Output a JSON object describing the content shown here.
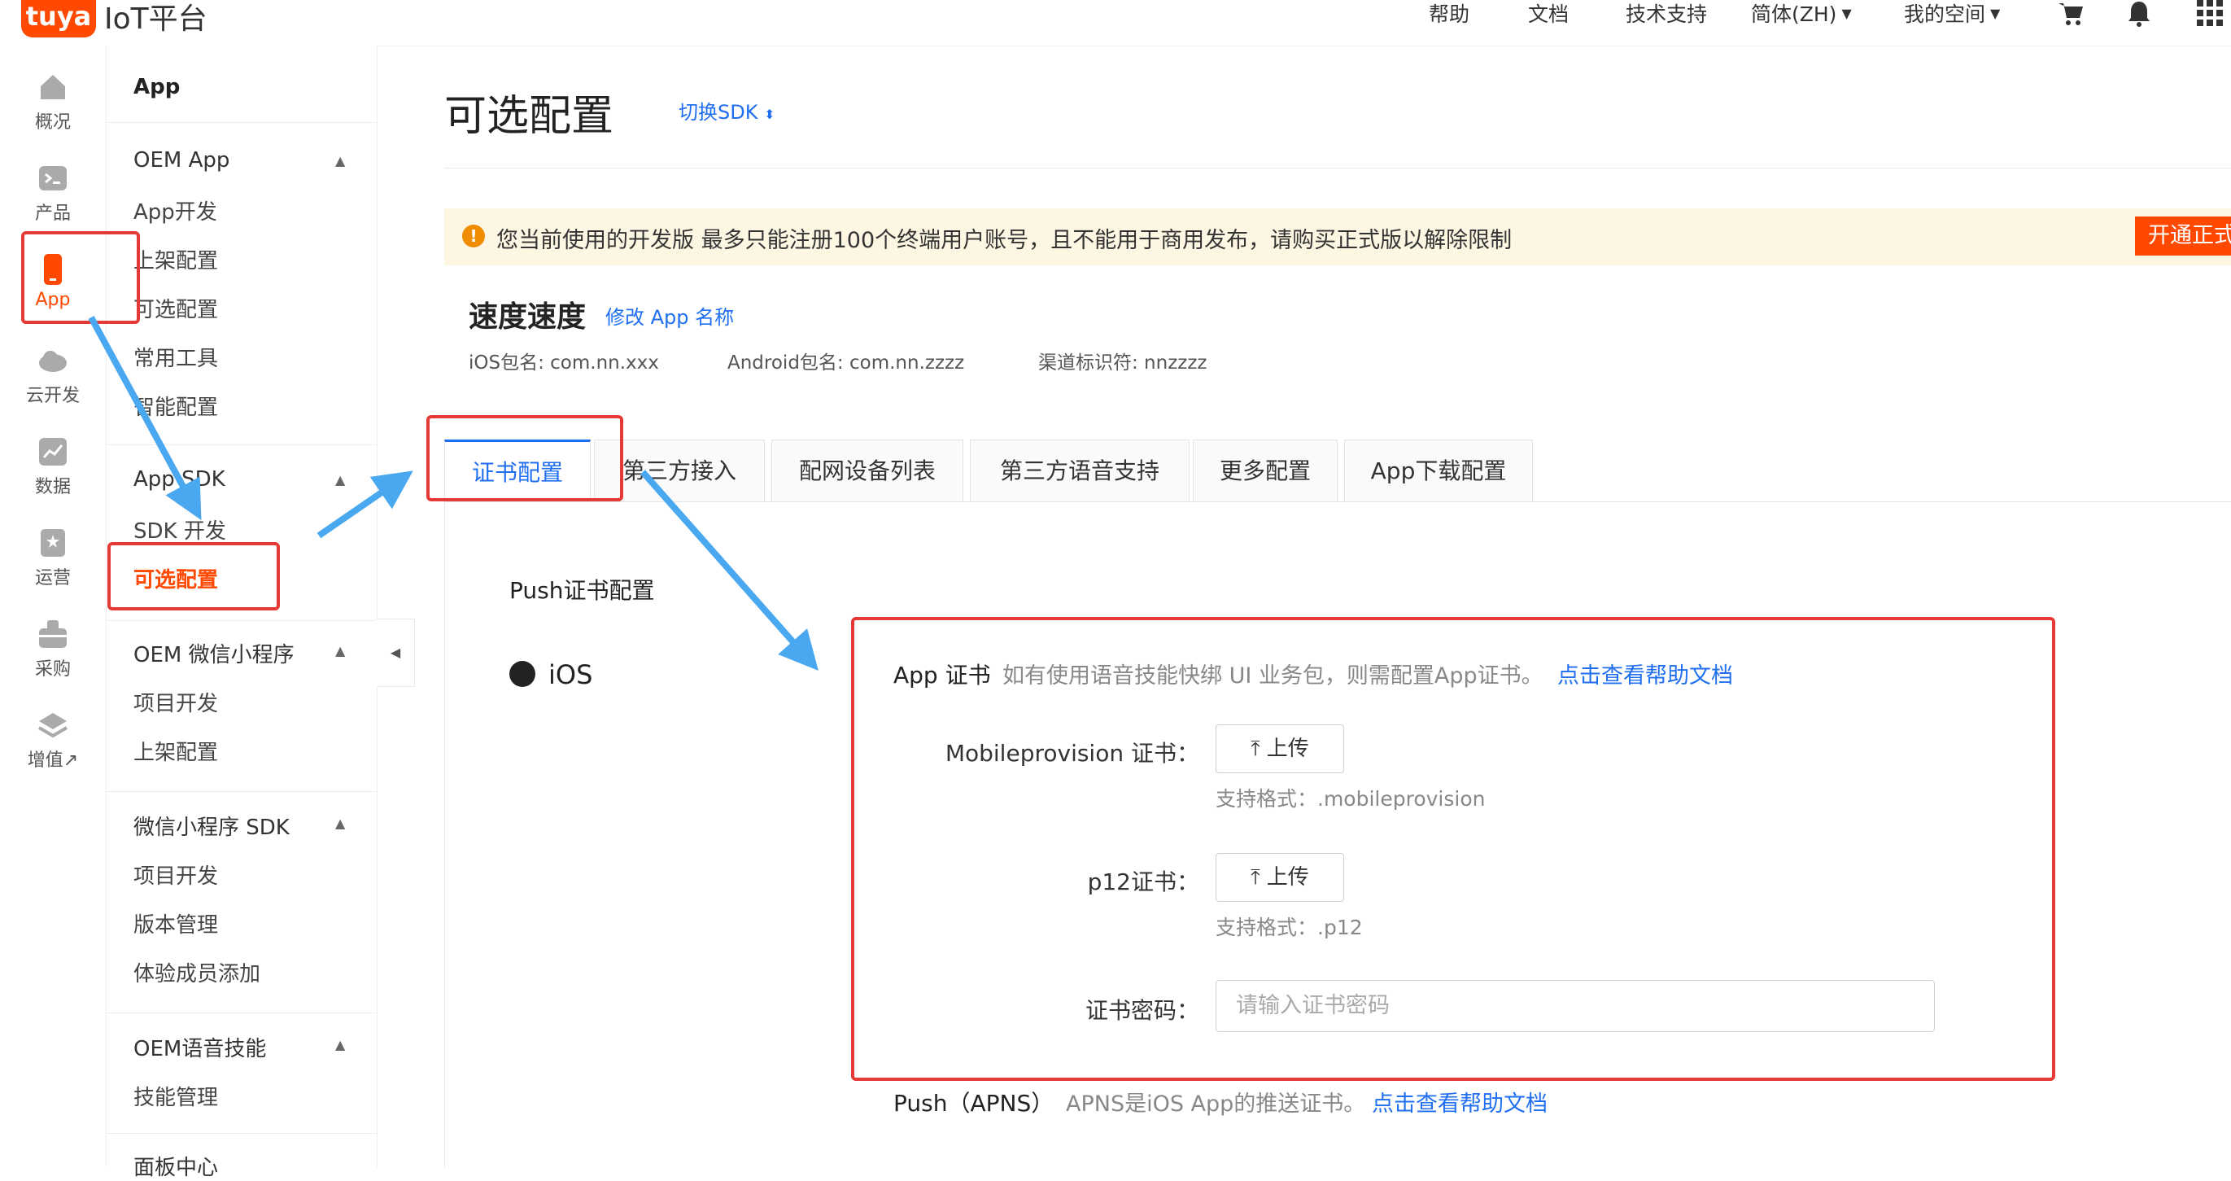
{
  "header": {
    "logo": "tuya",
    "platform": "IoT平台",
    "nav": [
      "帮助",
      "文档",
      "技术支持",
      "简体(ZH)",
      "我的空间"
    ],
    "icons": [
      "cart-icon",
      "bell-icon",
      "grid-icon"
    ]
  },
  "rail": [
    {
      "label": "概况",
      "icon": "home-icon"
    },
    {
      "label": "产品",
      "icon": "terminal-icon"
    },
    {
      "label": "App",
      "icon": "phone-icon",
      "active": true
    },
    {
      "label": "云开发",
      "icon": "cloud-icon"
    },
    {
      "label": "数据",
      "icon": "chart-icon"
    },
    {
      "label": "运营",
      "icon": "bookmark-icon"
    },
    {
      "label": "采购",
      "icon": "basket-icon"
    },
    {
      "label": "增值↗",
      "icon": "layers-icon"
    }
  ],
  "submenu": {
    "root": "App",
    "groups": [
      {
        "title": "OEM App",
        "items": [
          "App开发",
          "上架配置",
          "可选配置",
          "常用工具",
          "智能配置"
        ]
      },
      {
        "title": "App SDK",
        "items": [
          "SDK 开发",
          "可选配置"
        ],
        "active": "可选配置"
      },
      {
        "title": "OEM 微信小程序",
        "items": [
          "项目开发",
          "上架配置"
        ]
      },
      {
        "title": "微信小程序 SDK",
        "items": [
          "项目开发",
          "版本管理",
          "体验成员添加"
        ]
      },
      {
        "title": "OEM语音技能",
        "items": [
          "技能管理"
        ]
      },
      {
        "title": "面板中心",
        "items": []
      }
    ]
  },
  "page": {
    "title": "可选配置",
    "switch_sdk": "切换SDK",
    "warning": "您当前使用的开发版 最多只能注册100个终端用户账号，且不能用于商用发布，请购买正式版以解除限制",
    "warning_btn": "开通正式版",
    "app_name": "速度速度",
    "rename": "修改 App 名称",
    "ios_pkg": "iOS包名: com.nn.xxx",
    "android_pkg": "Android包名: com.nn.zzzz",
    "channel": "渠道标识符: nnzzzz"
  },
  "tabs": [
    "证书配置",
    "第三方接入",
    "配网设备列表",
    "第三方语音支持",
    "更多配置",
    "App下载配置"
  ],
  "cert": {
    "section_title": "Push证书配置",
    "platform": "iOS",
    "title": "App 证书",
    "desc": "如有使用语音技能快绑 UI 业务包，则需配置App证书。",
    "help_link": "点击查看帮助文档",
    "mobileprovision_label": "Mobileprovision 证书：",
    "upload": "上传",
    "mobileprovision_hint": "支持格式：.mobileprovision",
    "p12_label": "p12证书：",
    "p12_hint": "支持格式：.p12",
    "password_label": "证书密码：",
    "password_placeholder": "请输入证书密码",
    "apns_title": "Push（APNS）",
    "apns_desc": "APNS是iOS App的推送证书。",
    "apns_link": "点击查看帮助文档"
  },
  "colors": {
    "brand": "#ff4800",
    "link": "#1f6ff0",
    "annotation": "#e53935",
    "arrow": "#4aa8f0"
  }
}
